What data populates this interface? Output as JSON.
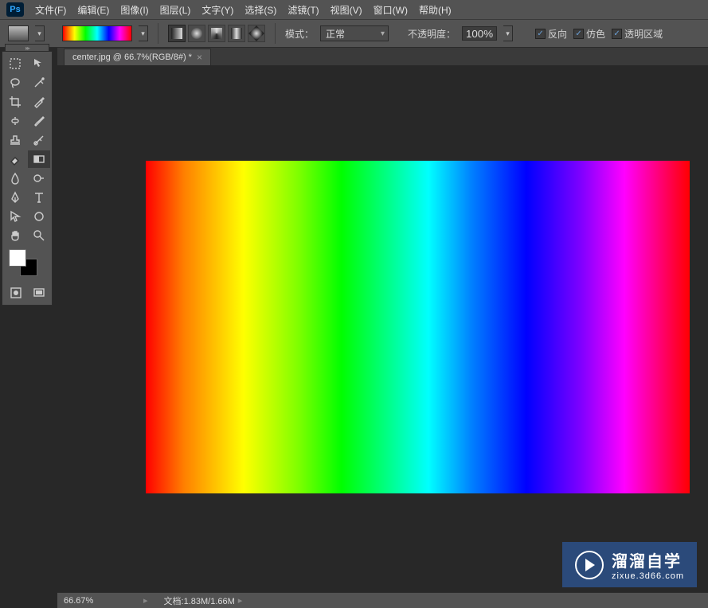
{
  "app": {
    "logo": "Ps"
  },
  "menu": {
    "file": "文件(F)",
    "edit": "编辑(E)",
    "image": "图像(I)",
    "layer": "图层(L)",
    "type": "文字(Y)",
    "select": "选择(S)",
    "filter": "滤镜(T)",
    "view": "视图(V)",
    "window": "窗口(W)",
    "help": "帮助(H)"
  },
  "options": {
    "mode_label": "模式：",
    "mode_value": "正常",
    "opacity_label": "不透明度：",
    "opacity_value": "100%",
    "reverse": "反向",
    "dither": "仿色",
    "transparency": "透明区域"
  },
  "document": {
    "tab_title": "center.jpg @ 66.7%(RGB/8#) *"
  },
  "status": {
    "zoom": "66.67%",
    "docinfo": "文档:1.83M/1.66M"
  },
  "watermark": {
    "title": "溜溜自学",
    "url": "zixue.3d66.com"
  }
}
